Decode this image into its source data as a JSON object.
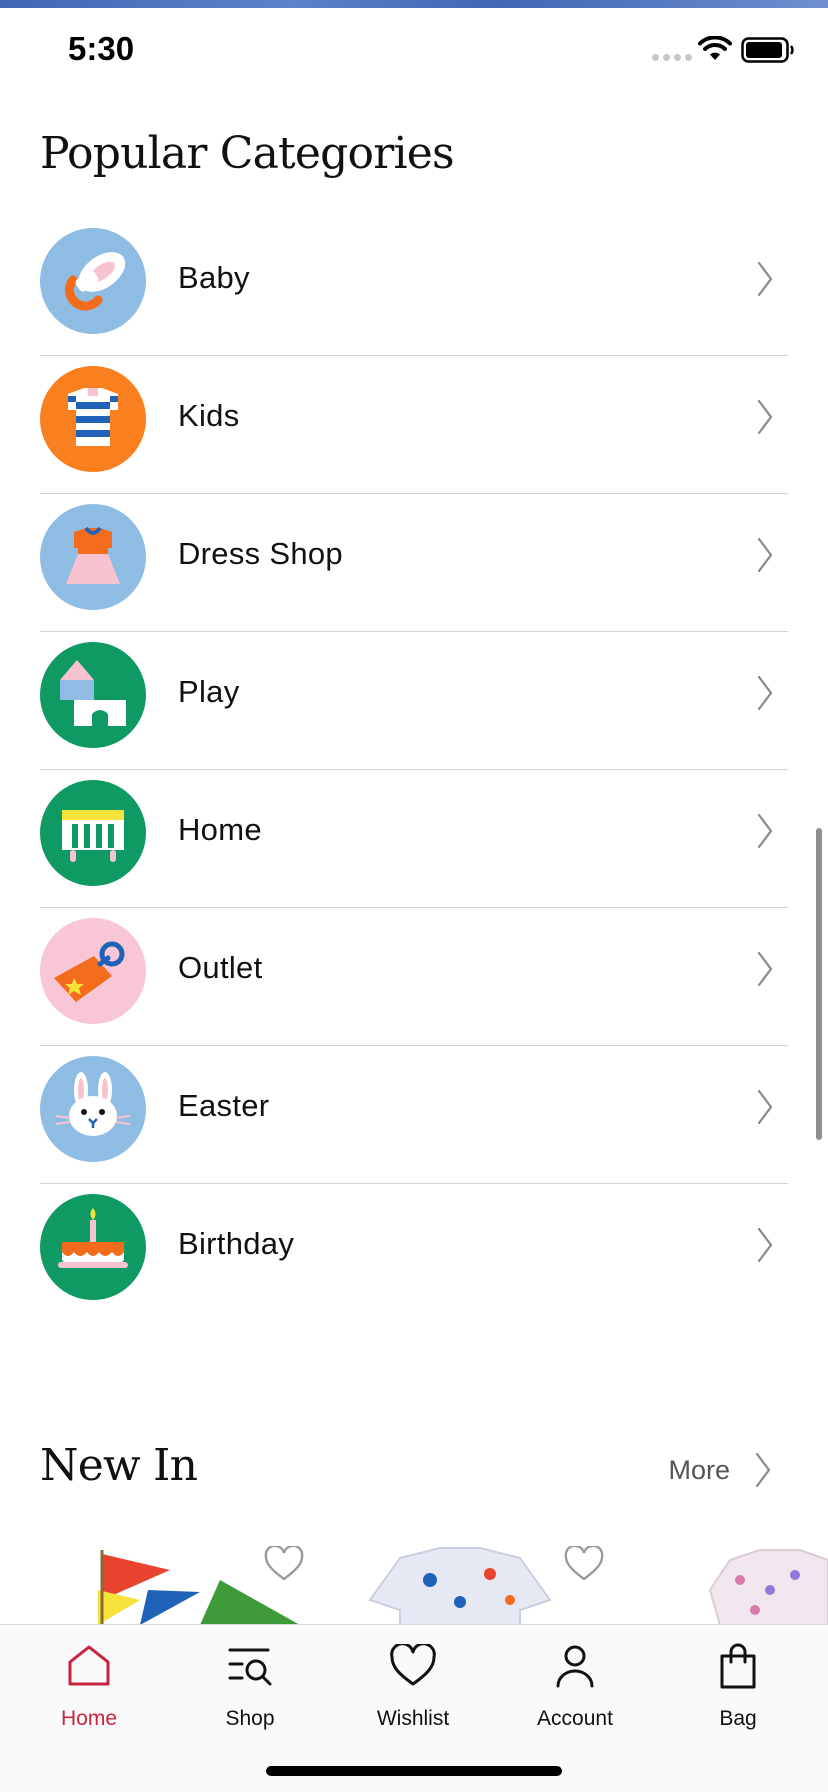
{
  "status_bar": {
    "time": "5:30"
  },
  "popular_categories": {
    "title": "Popular Categories",
    "items": [
      {
        "label": "Baby",
        "icon": "pacifier-icon",
        "bg": "#8fbce3"
      },
      {
        "label": "Kids",
        "icon": "striped-shirt-icon",
        "bg": "#fa7f1f"
      },
      {
        "label": "Dress Shop",
        "icon": "dress-icon",
        "bg": "#8fbce3"
      },
      {
        "label": "Play",
        "icon": "blocks-icon",
        "bg": "#0f9a63"
      },
      {
        "label": "Home",
        "icon": "crib-icon",
        "bg": "#0f9a63"
      },
      {
        "label": "Outlet",
        "icon": "price-tag-icon",
        "bg": "#f8c6d4"
      },
      {
        "label": "Easter",
        "icon": "bunny-icon",
        "bg": "#8fbce3"
      },
      {
        "label": "Birthday",
        "icon": "birthday-cake-icon",
        "bg": "#0f9a63"
      }
    ]
  },
  "new_in": {
    "title": "New In",
    "more_label": "More"
  },
  "tab_bar": {
    "accent_color": "#c8243f",
    "items": [
      {
        "label": "Home",
        "icon": "home-icon",
        "active": true
      },
      {
        "label": "Shop",
        "icon": "shop-search-icon",
        "active": false
      },
      {
        "label": "Wishlist",
        "icon": "heart-icon",
        "active": false
      },
      {
        "label": "Account",
        "icon": "person-icon",
        "active": false
      },
      {
        "label": "Bag",
        "icon": "shopping-bag-icon",
        "active": false
      }
    ]
  }
}
